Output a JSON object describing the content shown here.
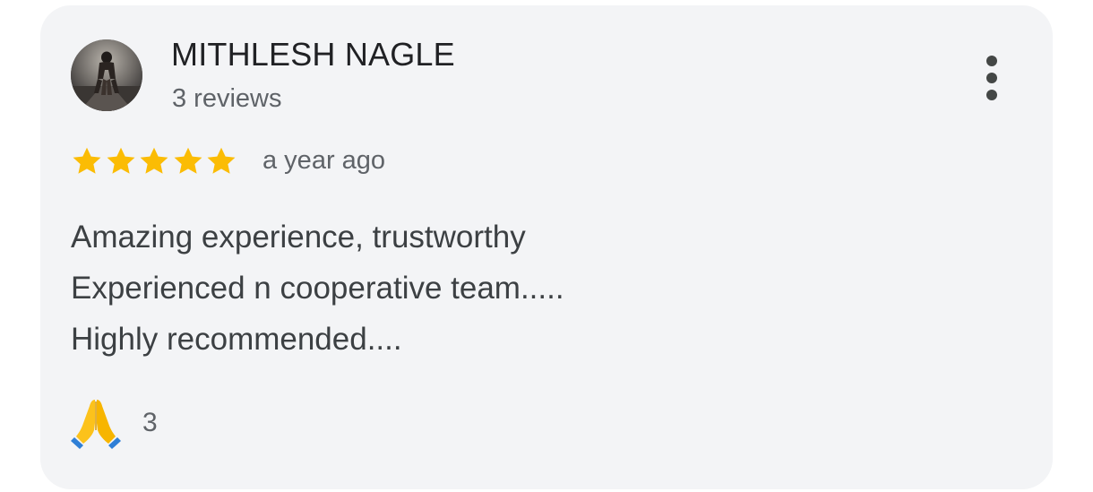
{
  "review": {
    "author_name": "MITHLESH NAGLE",
    "author_reviews": "3 reviews",
    "rating": 5,
    "rating_max": 5,
    "time_ago": "a year ago",
    "text_lines": [
      "Amazing experience, trustworthy",
      "Experienced n cooperative team.....",
      "Highly recommended...."
    ],
    "reaction_count": "3"
  },
  "icons": {
    "avatar": "runner-photo-avatar",
    "menu": "more-vert-icon",
    "star": "star-icon",
    "reaction": "folded-hands-icon"
  },
  "colors": {
    "card_background": "#f3f4f6",
    "star": "#fbbc04",
    "name": "#202124",
    "secondary_text": "#5f6368",
    "body_text": "#3c4043"
  }
}
